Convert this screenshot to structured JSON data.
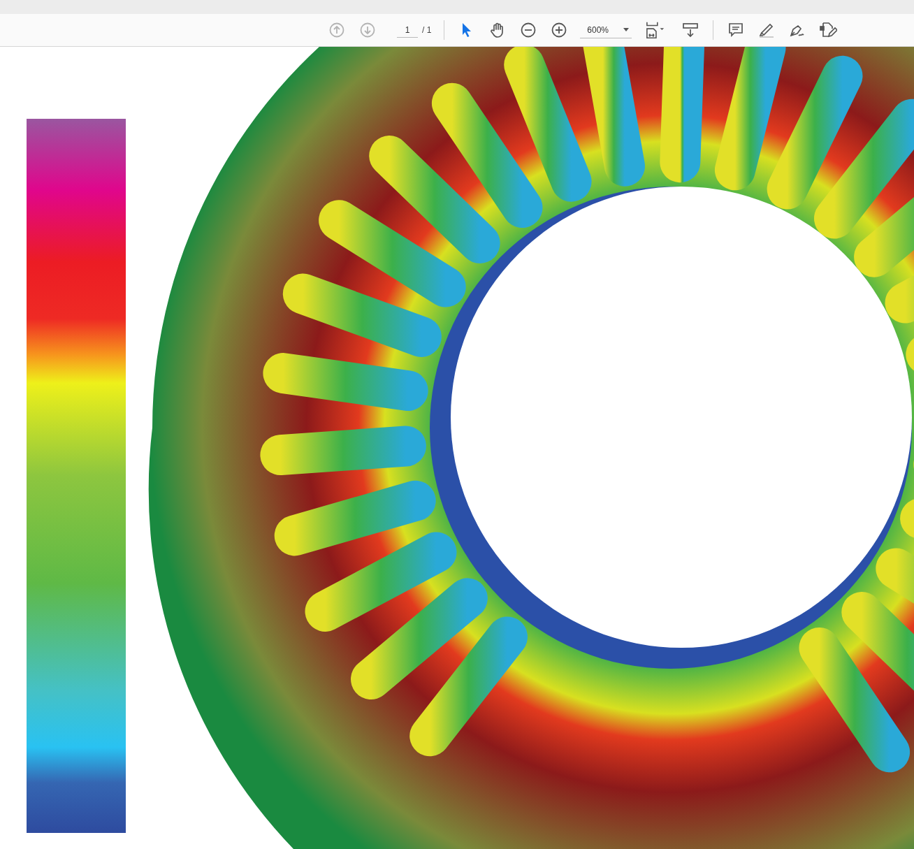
{
  "toolbar": {
    "nav_buttons": [
      {
        "kind": "up",
        "disabled": true
      },
      {
        "kind": "down",
        "disabled": true
      }
    ],
    "page_number": "1",
    "page_total": "/ 1",
    "tools": [
      {
        "kind": "select",
        "selected": true
      },
      {
        "kind": "hand",
        "selected": false
      }
    ],
    "zoom": "600%"
  }
}
